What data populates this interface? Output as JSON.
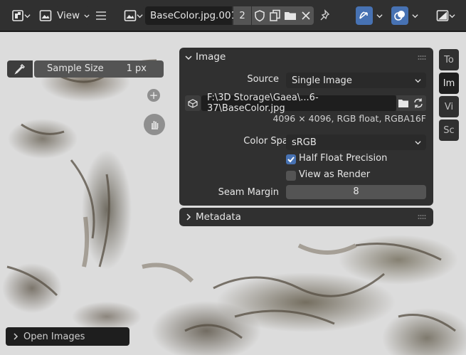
{
  "header": {
    "editor_type_icon": "image-editor-icon",
    "view_menu_label": "View",
    "image_name": "BaseColor.jpg.001",
    "user_count": "2"
  },
  "toolbar": {
    "sample_size_label": "Sample Size",
    "sample_size_value": "1 px"
  },
  "image_panel": {
    "title": "Image",
    "source_label": "Source",
    "source_value": "Single Image",
    "filepath": "F:\\3D Storage\\Gaea\\...6-37\\BaseColor.jpg",
    "info": "4096 × 4096,  RGB float, RGBA16F",
    "color_space_label": "Color Space",
    "color_space_value": "sRGB",
    "half_float_label": "Half Float Precision",
    "half_float_checked": true,
    "view_as_render_label": "View as Render",
    "view_as_render_checked": false,
    "seam_margin_label": "Seam Margin",
    "seam_margin_value": "8"
  },
  "metadata_panel": {
    "title": "Metadata"
  },
  "side_tabs": [
    {
      "label": "To",
      "active": false
    },
    {
      "label": "Im",
      "active": true
    },
    {
      "label": "Vi",
      "active": false
    },
    {
      "label": "Sc",
      "active": false
    }
  ],
  "open_images_label": "Open Images",
  "colors": {
    "accent": "#4772b3",
    "header_bg": "#303030",
    "panel_bg": "#303030",
    "field_bg": "#545454"
  }
}
